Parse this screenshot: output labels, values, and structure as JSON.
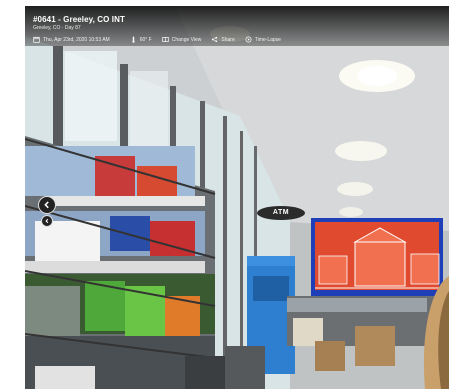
{
  "camera": {
    "title": "#0641 - Greeley, CO INT",
    "subtitle": "Greeley, CO · Day 87"
  },
  "toolbar": {
    "datetime": "Thu, Apr 23rd, 2020 10:53 AM",
    "temperature": "60° F",
    "change_view": "Change View",
    "share": "Share",
    "time_lapse": "Time-Lapse"
  },
  "scene": {
    "atm_sign": "ATM"
  },
  "icons": {
    "calendar": "calendar-icon",
    "thermometer": "thermometer-icon",
    "change_view": "change-view-icon",
    "share": "share-icon",
    "time_lapse": "time-lapse-icon",
    "prev": "chevron-left-icon"
  },
  "colors": {
    "overlay_bg": "#000000",
    "screen_red": "#e04a2e",
    "screen_border": "#1f3fb8",
    "cooler_blue": "#2e7fd0"
  }
}
